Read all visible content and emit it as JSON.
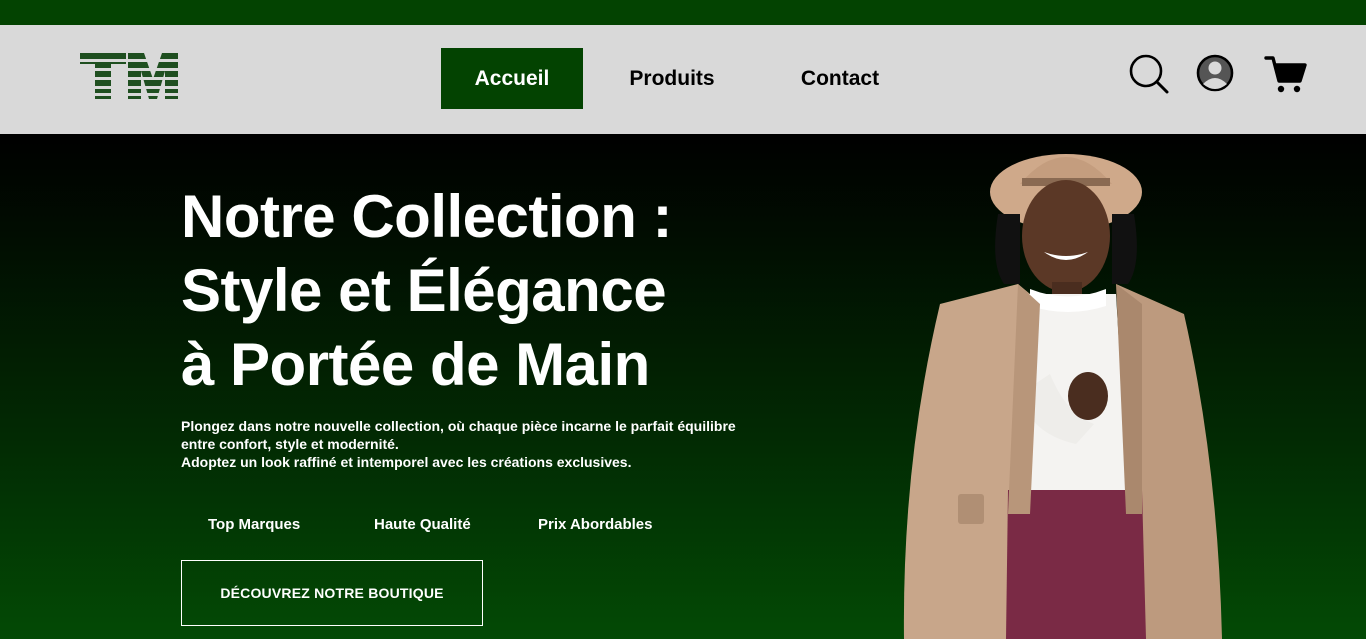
{
  "brand": {
    "logo_text": "TM",
    "primary_color": "#034301",
    "header_bg": "#d9d9d9"
  },
  "nav": {
    "items": [
      {
        "label": "Accueil",
        "active": true
      },
      {
        "label": "Produits",
        "active": false
      },
      {
        "label": "Contact",
        "active": false
      }
    ],
    "icons": [
      "search-icon",
      "user-account-icon",
      "shopping-cart-icon"
    ]
  },
  "hero": {
    "title_lines": [
      "Notre Collection :",
      "Style et Élégance",
      "à Portée de Main"
    ],
    "description_lines": [
      "Plongez dans notre nouvelle collection, où chaque pièce incarne le parfait équilibre",
      "entre confort, style et modernité.",
      "Adoptez un look raffiné et intemporel avec les créations exclusives."
    ],
    "features": [
      "Top Marques",
      "Haute Qualité",
      "Prix Abordables"
    ],
    "cta_label": "DÉCOUVREZ NOTRE BOUTIQUE"
  }
}
